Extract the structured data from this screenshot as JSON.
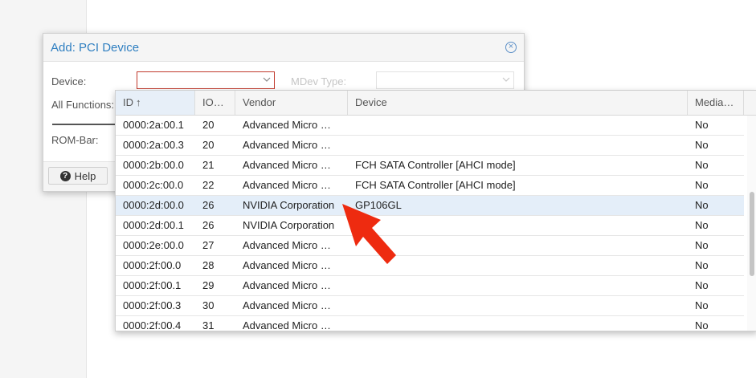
{
  "dialog": {
    "title": "Add: PCI Device",
    "device_label": "Device:",
    "device_value": "",
    "mdev_label": "MDev Type:",
    "all_functions_label": "All Functions:",
    "rom_bar_label": "ROM-Bar:",
    "help_label": "Help"
  },
  "grid": {
    "columns": [
      "ID",
      "IO…",
      "Vendor",
      "Device",
      "Media…"
    ],
    "rows": [
      {
        "id": "0000:2a:00.1",
        "io": "20",
        "vendor": "Advanced Micro …",
        "device": "",
        "media": "No"
      },
      {
        "id": "0000:2a:00.3",
        "io": "20",
        "vendor": "Advanced Micro …",
        "device": "",
        "media": "No"
      },
      {
        "id": "0000:2b:00.0",
        "io": "21",
        "vendor": "Advanced Micro …",
        "device": "FCH SATA Controller [AHCI mode]",
        "media": "No"
      },
      {
        "id": "0000:2c:00.0",
        "io": "22",
        "vendor": "Advanced Micro …",
        "device": "FCH SATA Controller [AHCI mode]",
        "media": "No"
      },
      {
        "id": "0000:2d:00.0",
        "io": "26",
        "vendor": "NVIDIA Corporation",
        "device": "GP106GL",
        "media": "No"
      },
      {
        "id": "0000:2d:00.1",
        "io": "26",
        "vendor": "NVIDIA Corporation",
        "device": "",
        "media": "No"
      },
      {
        "id": "0000:2e:00.0",
        "io": "27",
        "vendor": "Advanced Micro …",
        "device": "",
        "media": "No"
      },
      {
        "id": "0000:2f:00.0",
        "io": "28",
        "vendor": "Advanced Micro …",
        "device": "",
        "media": "No"
      },
      {
        "id": "0000:2f:00.1",
        "io": "29",
        "vendor": "Advanced Micro …",
        "device": "",
        "media": "No"
      },
      {
        "id": "0000:2f:00.3",
        "io": "30",
        "vendor": "Advanced Micro …",
        "device": "",
        "media": "No"
      },
      {
        "id": "0000:2f:00.4",
        "io": "31",
        "vendor": "Advanced Micro …",
        "device": "",
        "media": "No"
      }
    ]
  },
  "colors": {
    "accent": "#2f7fc1",
    "selected_row": "#e4eef9",
    "pointer_arrow": "#ee2b10",
    "device_border": "#c0392b"
  },
  "icons": {
    "close": "close-circle-icon",
    "help": "help-icon",
    "sort": "sort-ascending-icon",
    "dropdown": "chevron-down-icon"
  }
}
